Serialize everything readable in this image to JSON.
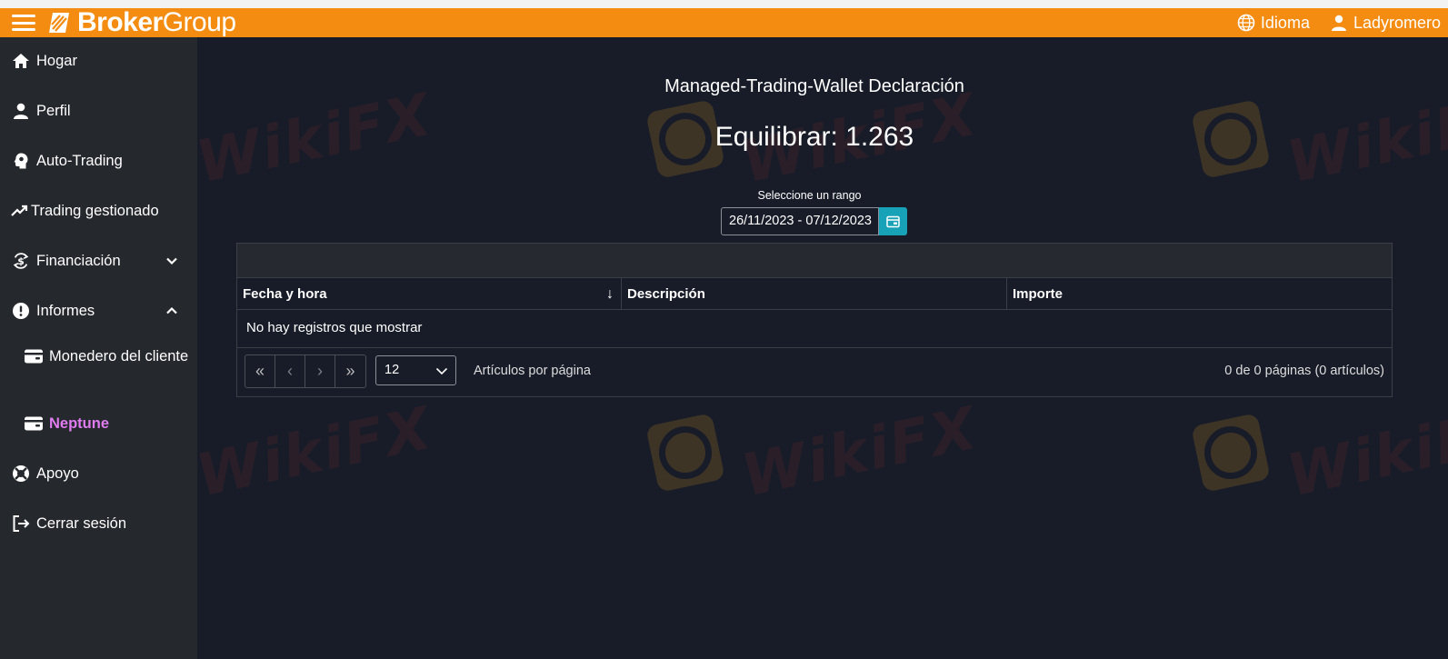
{
  "brand": {
    "name_bold": "Broker",
    "name_light": "Group"
  },
  "topbar": {
    "language_label": "Idioma",
    "user_label": "Ladyromero"
  },
  "sidebar": {
    "items": [
      {
        "label": "Hogar"
      },
      {
        "label": "Perfil"
      },
      {
        "label": "Auto-Trading"
      },
      {
        "label": "Trading gestionado"
      },
      {
        "label": "Financiación"
      },
      {
        "label": "Informes"
      },
      {
        "label": "Apoyo"
      },
      {
        "label": "Cerrar sesión"
      }
    ],
    "subitems": [
      {
        "label": "Monedero del cliente"
      },
      {
        "label": "Neptune"
      }
    ]
  },
  "main": {
    "title": "Managed-Trading-Wallet Declaración",
    "balance": "Equilibrar: 1.263",
    "range_label": "Seleccione un rango",
    "range_value": "26/11/2023 - 07/12/2023"
  },
  "table": {
    "columns": [
      "Fecha y hora",
      "Descripción",
      "Importe"
    ],
    "sort_indicator": "↓",
    "empty_message": "No hay registros que mostrar",
    "page_size": "12",
    "per_page_label": "Artículos por página",
    "page_info": "0 de 0 páginas (0 artículos)"
  },
  "watermark": {
    "text": "WikiFX"
  },
  "colors": {
    "accent": "#f48c12",
    "sidebar": "#25282d",
    "main_bg": "#181c28",
    "active": "#e07cf0",
    "button": "#17a2b8"
  }
}
